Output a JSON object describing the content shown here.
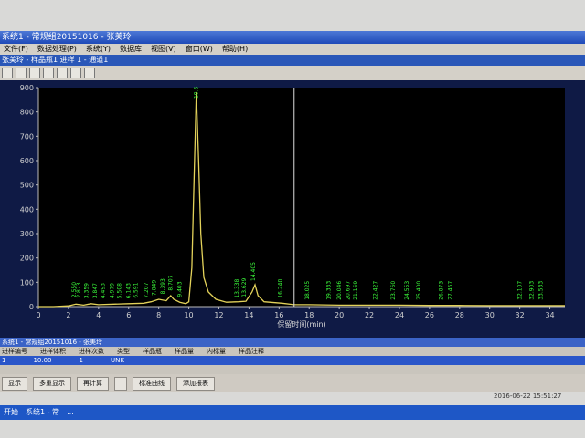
{
  "window": {
    "title": "系统1 - 常规组20151016 - 张美玲",
    "subtitle": "张美玲 - 样品瓶1 进样 1 - 通道1"
  },
  "menus": [
    "文件(F)",
    "数据处理(P)",
    "系统(Y)",
    "数据库",
    "视图(V)",
    "窗口(W)",
    "帮助(H)"
  ],
  "chart_data": {
    "type": "line",
    "xlabel": "保留时间(min)",
    "ylabel": "",
    "xlim": [
      0,
      35
    ],
    "ylim": [
      0,
      900
    ],
    "xticks": [
      0,
      2,
      4,
      6,
      8,
      10,
      12,
      14,
      16,
      18,
      20,
      22,
      24,
      26,
      28,
      30,
      32,
      34
    ],
    "yticks": [
      0,
      100,
      200,
      300,
      400,
      500,
      600,
      700,
      800,
      900
    ],
    "peak_labels": [
      {
        "x": 2.5,
        "y": 22,
        "label": "2.550"
      },
      {
        "x": 2.8,
        "y": 20,
        "label": "2.873"
      },
      {
        "x": 3.3,
        "y": 18,
        "label": "3.359"
      },
      {
        "x": 3.9,
        "y": 18,
        "label": "3.847"
      },
      {
        "x": 4.4,
        "y": 18,
        "label": "4.493"
      },
      {
        "x": 5.0,
        "y": 18,
        "label": "4.979"
      },
      {
        "x": 5.5,
        "y": 18,
        "label": "5.508"
      },
      {
        "x": 6.1,
        "y": 18,
        "label": "6.143"
      },
      {
        "x": 6.6,
        "y": 20,
        "label": "6.591"
      },
      {
        "x": 7.3,
        "y": 20,
        "label": "7.207"
      },
      {
        "x": 7.8,
        "y": 30,
        "label": "7.849"
      },
      {
        "x": 8.4,
        "y": 36,
        "label": "8.393"
      },
      {
        "x": 8.9,
        "y": 50,
        "label": "8.707"
      },
      {
        "x": 9.5,
        "y": 24,
        "label": "9.403"
      },
      {
        "x": 10.6,
        "y": 840,
        "label": "10.6"
      },
      {
        "x": 13.3,
        "y": 20,
        "label": "13.338"
      },
      {
        "x": 13.8,
        "y": 24,
        "label": "13.629"
      },
      {
        "x": 14.4,
        "y": 90,
        "label": "14.405"
      },
      {
        "x": 16.2,
        "y": 20,
        "label": "16.240"
      },
      {
        "x": 18.0,
        "y": 12,
        "label": "18.025"
      },
      {
        "x": 19.4,
        "y": 12,
        "label": "19.333"
      },
      {
        "x": 20.1,
        "y": 12,
        "label": "20.046"
      },
      {
        "x": 20.7,
        "y": 12,
        "label": "20.697"
      },
      {
        "x": 21.2,
        "y": 12,
        "label": "21.169"
      },
      {
        "x": 22.5,
        "y": 12,
        "label": "22.427"
      },
      {
        "x": 23.7,
        "y": 12,
        "label": "23.760"
      },
      {
        "x": 24.6,
        "y": 12,
        "label": "24.553"
      },
      {
        "x": 25.4,
        "y": 12,
        "label": "25.400"
      },
      {
        "x": 26.9,
        "y": 12,
        "label": "26.873"
      },
      {
        "x": 27.5,
        "y": 12,
        "label": "27.467"
      },
      {
        "x": 32.1,
        "y": 12,
        "label": "32.107"
      },
      {
        "x": 32.9,
        "y": 12,
        "label": "32.903"
      },
      {
        "x": 33.5,
        "y": 12,
        "label": "33.533"
      }
    ],
    "series": [
      {
        "x": [
          0,
          1,
          2,
          2.5,
          3,
          3.5,
          4,
          5,
          6,
          7,
          7.5,
          8,
          8.5,
          8.8,
          9.0,
          9.4,
          9.8,
          10.0,
          10.2,
          10.35,
          10.5,
          10.65,
          10.8,
          11.0,
          11.3,
          11.8,
          12.5,
          13.3,
          13.8,
          14.2,
          14.4,
          14.6,
          15.0,
          16.2,
          17,
          18,
          20,
          22,
          24,
          26,
          28,
          30,
          32,
          34,
          35
        ],
        "values": [
          0,
          0,
          3,
          10,
          6,
          12,
          8,
          10,
          12,
          14,
          20,
          30,
          24,
          45,
          30,
          18,
          12,
          20,
          160,
          520,
          880,
          600,
          300,
          120,
          60,
          30,
          18,
          20,
          22,
          60,
          90,
          45,
          20,
          14,
          8,
          8,
          6,
          6,
          6,
          5,
          5,
          4,
          4,
          4,
          4
        ]
      }
    ]
  },
  "cursor": {
    "x": 17.0
  },
  "table": {
    "header": "系统1 - 常规组20151016 - 张美玲",
    "columns": [
      "进样编号",
      "进样体积",
      "进样次数",
      "类型",
      "样品瓶",
      "样品量",
      "内标量",
      "样品注释"
    ],
    "row": [
      "1",
      "10.00",
      "1",
      "UNK",
      "",
      "",
      "",
      ""
    ]
  },
  "buttons": [
    "显示",
    "多重显示",
    "再计算",
    "",
    "标准曲线",
    "添加报表",
    "",
    "",
    ""
  ],
  "taskbar": {
    "start": "开始",
    "items": [
      "系统1 - 常",
      "..."
    ]
  },
  "clock": "2016-06-22 15:51:27"
}
